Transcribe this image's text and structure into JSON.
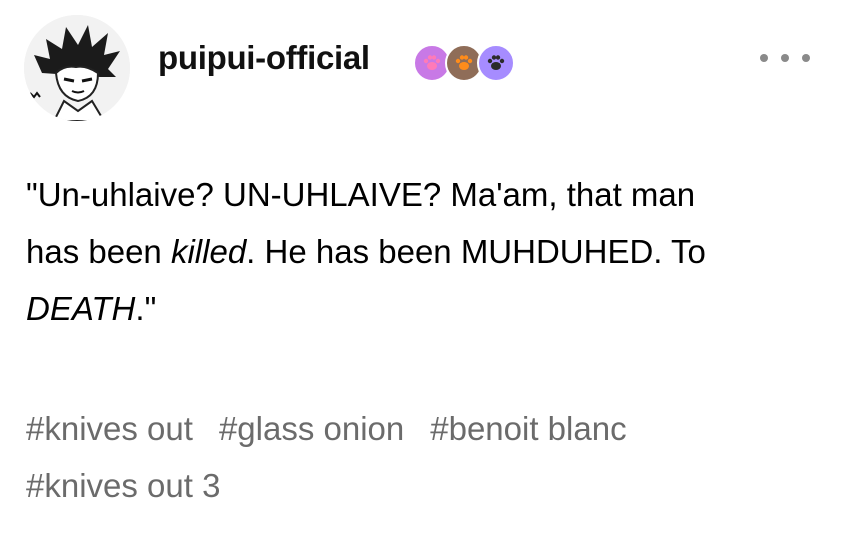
{
  "post": {
    "author": {
      "username": "puipui-official",
      "avatar_icon": "manga-character-avatar",
      "badges": [
        {
          "icon": "paw-badge-icon",
          "color": "#c879e6",
          "inner": "#ff7ab8"
        },
        {
          "icon": "paw-badge-icon",
          "color": "#8f6d58",
          "inner": "#ff8c1a"
        },
        {
          "icon": "paw-badge-icon",
          "color": "#a68cff",
          "inner": "#2b2b2b"
        }
      ]
    },
    "more_icon": "more-options-icon",
    "body": {
      "line1": "\"Un-uhlaive?  UN-UHLAIVE?  Ma'am, that man",
      "line2_start": "has been ",
      "line2_emphasis": "killed",
      "line2_end": ".  He has been MUHDUHED.  To",
      "line3_emphasis": "DEATH",
      "line3_end": ".\""
    },
    "tags": [
      "#knives out",
      "#glass onion",
      "#benoit blanc",
      "#knives out 3"
    ]
  }
}
